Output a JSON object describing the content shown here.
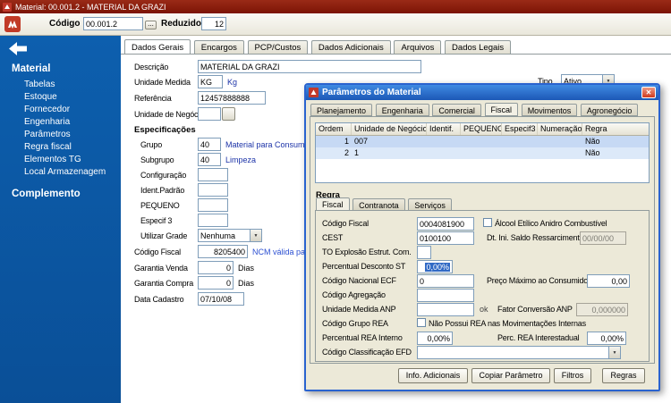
{
  "titlebar": {
    "title": "Material: 00.001.2 - MATERIAL DA GRAZI"
  },
  "toolbar": {
    "codigo_label": "Código",
    "codigo_value": "00.001.2",
    "lookup_label": "...",
    "reduzido_label": "Reduzido",
    "reduzido_value": "12"
  },
  "sidebar": {
    "material_title": "Material",
    "material_items": [
      "Tabelas",
      "Estoque",
      "Fornecedor",
      "Engenharia",
      "Parâmetros",
      "Regra fiscal",
      "Elementos TG",
      "Local Armazenagem"
    ],
    "complemento_title": "Complemento"
  },
  "tabs": {
    "items": [
      "Dados Gerais",
      "Encargos",
      "PCP/Custos",
      "Dados Adicionais",
      "Arquivos",
      "Dados Legais"
    ],
    "active": "Dados Gerais"
  },
  "form": {
    "descricao_label": "Descrição",
    "descricao_value": "MATERIAL DA GRAZI",
    "tipo_label": "Tipo",
    "tipo_value": "Ativo",
    "unidade_medida_label": "Unidade Medida",
    "unidade_medida_value": "KG",
    "unidade_medida_desc": "Kg",
    "referencia_label": "Referência",
    "referencia_value": "12457888888",
    "unidade_negocio_label": "Unidade de Negócio",
    "especificacoes_title": "Especificações",
    "grupo_label": "Grupo",
    "grupo_value": "40",
    "grupo_desc": "Material para Consumo",
    "subgrupo_label": "Subgrupo",
    "subgrupo_value": "40",
    "subgrupo_desc": "Limpeza",
    "configuracao_label": "Configuração",
    "ident_padrao_label": "Ident.Padrão",
    "pequeno_label": "PEQUENO",
    "especif3_label": "Especif 3",
    "utilizar_grade_label": "Utilizar Grade",
    "utilizar_grade_value": "Nenhuma",
    "codigo_fiscal_label": "Código Fiscal",
    "codigo_fiscal_value": "8205400",
    "codigo_fiscal_desc": "NCM válida para NFe",
    "garantia_venda_label": "Garantia Venda",
    "garantia_venda_value": "0",
    "garantia_venda_unit": "Dias",
    "garantia_compra_label": "Garantia Compra",
    "garantia_compra_value": "0",
    "garantia_compra_unit": "Dias",
    "data_cadastro_label": "Data Cadastro",
    "data_cadastro_value": "07/10/08"
  },
  "dialog": {
    "title": "Parâmetros do Material",
    "tabs": [
      "Planejamento",
      "Engenharia",
      "Comercial",
      "Fiscal",
      "Movimentos",
      "Agronegócio"
    ],
    "active_tab": "Fiscal",
    "grid": {
      "columns": [
        "Ordem",
        "Unidade de Negócio",
        "Identif.",
        "PEQUENO",
        "Especif3",
        "Numeração",
        "Regra"
      ],
      "rows": [
        {
          "cells": [
            "1",
            "007",
            "",
            "",
            "",
            "",
            "Não"
          ]
        },
        {
          "cells": [
            "2",
            "1",
            "",
            "",
            "",
            "",
            "Não"
          ]
        }
      ]
    },
    "regra_title": "Regra",
    "sub_tabs": [
      "Fiscal",
      "Contranota",
      "Serviços"
    ],
    "active_sub_tab": "Fiscal",
    "fields": {
      "codigo_fiscal_label": "Código Fiscal",
      "codigo_fiscal_value": "0004081900",
      "alcool_label": "Álcool Etílico Anidro Combustível",
      "cest_label": "CEST",
      "cest_value": "0100100",
      "dt_ini_label": "Dt. Ini. Saldo Ressarcimento",
      "dt_ini_value": "00/00/00",
      "to_explosao_label": "TO Explosão Estrut. Com.",
      "perc_desconto_st_label": "Percentual Desconto ST",
      "perc_desconto_st_value": "0,00%",
      "codigo_nacional_ecf_label": "Código Nacional ECF",
      "codigo_nacional_ecf_value": "0",
      "preco_maximo_label": "Preço Máximo ao Consumidor",
      "preco_maximo_value": "0,00",
      "codigo_agregacao_label": "Código Agregação",
      "unidade_medida_anp_label": "Unidade Medida ANP",
      "unidade_medida_anp_desc": "ok",
      "fator_conversao_anp_label": "Fator Conversão ANP",
      "fator_conversao_anp_value": "0,000000",
      "codigo_grupo_rea_label": "Código Grupo REA",
      "nao_possui_rea_label": "Não Possui REA nas Movimentações Internas",
      "perc_rea_interno_label": "Percentual REA Interno",
      "perc_rea_interno_value": "0,00%",
      "perc_rea_interestadual_label": "Perc. REA Interestadual",
      "perc_rea_interestadual_value": "0,00%",
      "codigo_classificacao_efd_label": "Código Classificação EFD"
    },
    "buttons": [
      "Info. Adicionais",
      "Copiar Parâmetro",
      "Filtros",
      "Regras"
    ]
  },
  "icons": {
    "dropdown_arrow": "▼",
    "close": "✕"
  },
  "colors": {
    "titlebar_red": "#851709",
    "sidebar_blue": "#0b57a4",
    "selection_blue": "#316ac5",
    "dialog_frame_blue": "#2a63cf"
  }
}
